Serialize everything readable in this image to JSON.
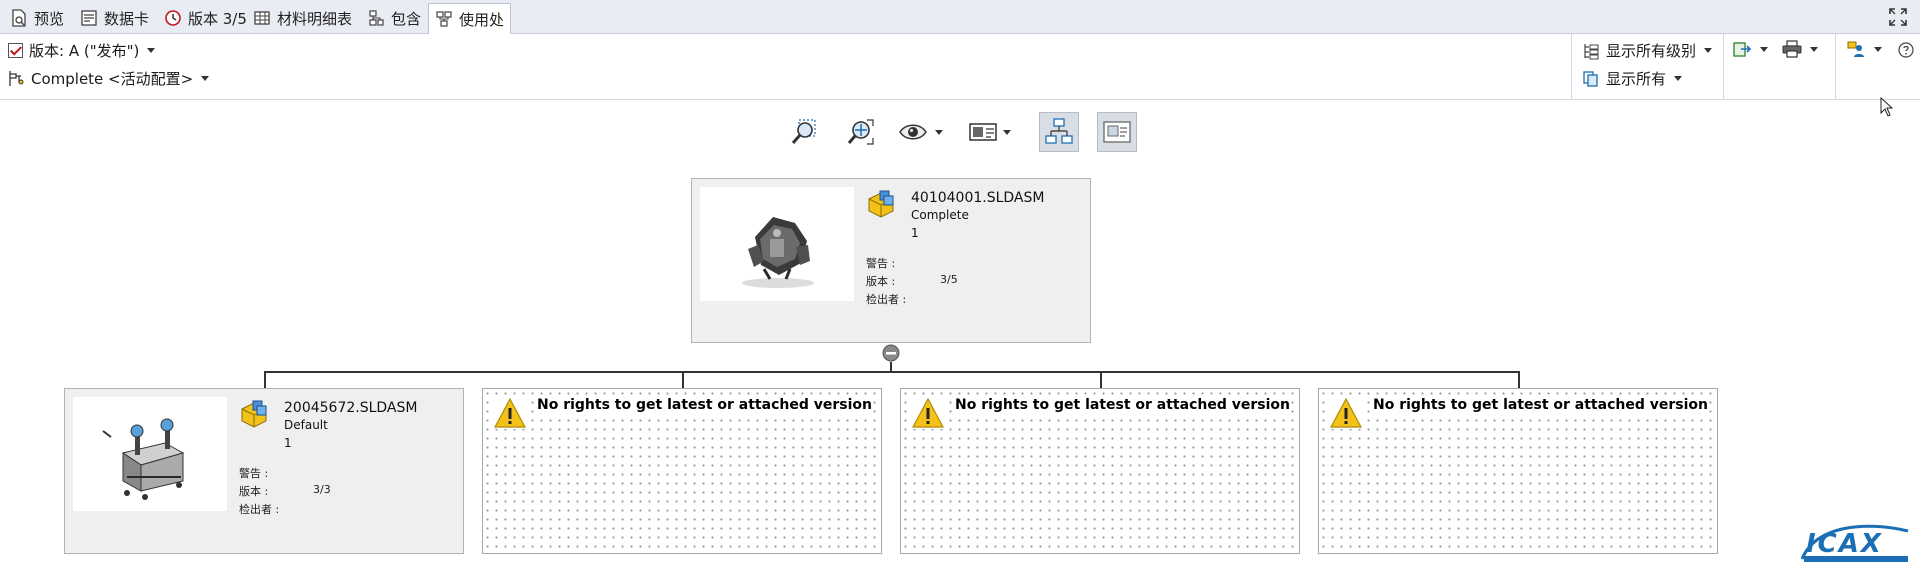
{
  "tabs": [
    {
      "label": "预览",
      "icon": "preview-icon",
      "active": false
    },
    {
      "label": "数据卡",
      "icon": "datacard-icon",
      "active": false
    },
    {
      "label": "版本 3/5",
      "icon": "version-history-icon",
      "active": false
    },
    {
      "label": "材料明细表",
      "icon": "bom-table-icon",
      "active": false
    },
    {
      "label": "包含",
      "icon": "contains-icon",
      "active": false
    },
    {
      "label": "使用处",
      "icon": "where-used-icon",
      "active": true
    }
  ],
  "toolbar": {
    "version_label": "版本: A (\"发布\")",
    "config_label": "Complete <活动配置>",
    "show_all_levels": "显示所有级别",
    "show_all": "显示所有"
  },
  "root_card": {
    "filename": "40104001.SLDASM",
    "config": "Complete",
    "count": "1",
    "warning_label": "警告 :",
    "version_label": "版本 :",
    "version_value": "3/5",
    "checkout_label": "检出者 :"
  },
  "child_card": {
    "filename": "20045672.SLDASM",
    "config": "Default",
    "count": "1",
    "warning_label": "警告 :",
    "version_label": "版本 :",
    "version_value": "3/3",
    "checkout_label": "检出者 :"
  },
  "no_rights": [
    {
      "message": "No rights to get latest or attached version"
    },
    {
      "message": "No rights to get latest or attached version"
    },
    {
      "message": "No rights to get latest or attached version"
    }
  ],
  "colors": {
    "tabbar_bg": "#e9ecf3",
    "card_bg": "#efefef",
    "warning_yellow": "#f2c21b",
    "checkbox_red": "#c4161c",
    "logo_blue": "#1c6fb5"
  }
}
